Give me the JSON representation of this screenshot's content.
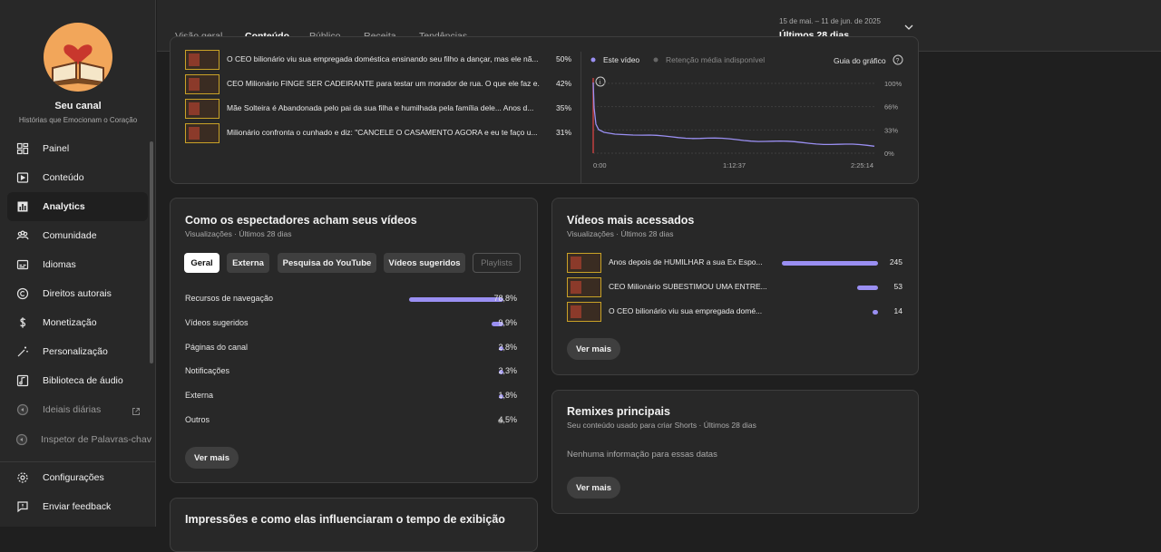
{
  "channel": {
    "name": "Seu canal",
    "subtitle": "Histórias que Emocionam o Coração"
  },
  "sidebar": {
    "items": [
      {
        "label": "Painel",
        "icon": "dashboard-icon"
      },
      {
        "label": "Conteúdo",
        "icon": "content-icon"
      },
      {
        "label": "Analytics",
        "icon": "analytics-icon",
        "active": true
      },
      {
        "label": "Comunidade",
        "icon": "community-icon"
      },
      {
        "label": "Idiomas",
        "icon": "subtitles-icon"
      },
      {
        "label": "Direitos autorais",
        "icon": "copyright-icon"
      },
      {
        "label": "Monetização",
        "icon": "dollar-icon"
      },
      {
        "label": "Personalização",
        "icon": "magic-wand-icon"
      },
      {
        "label": "Biblioteca de áudio",
        "icon": "audio-library-icon"
      },
      {
        "label": "Ideiais diárias",
        "icon": "extension-icon",
        "dim": true,
        "external": true
      },
      {
        "label": "Inspetor de Palavras-chav",
        "icon": "extension-icon",
        "dim": true
      }
    ],
    "bottom": [
      {
        "label": "Configurações",
        "icon": "gear-icon"
      },
      {
        "label": "Enviar feedback",
        "icon": "feedback-icon"
      }
    ]
  },
  "tabs": [
    "Visão geral",
    "Conteúdo",
    "Público",
    "Receita",
    "Tendências"
  ],
  "active_tab": 1,
  "date": {
    "range": "15 de mai. – 11 de jun. de 2025",
    "label": "Últimos 28 dias"
  },
  "retention_list": [
    {
      "title": "O CEO bilionário viu sua empregada doméstica ensinando seu filho a dançar, mas ele nã...",
      "value": "50%"
    },
    {
      "title": "CEO Milionário FINGE SER CADEIRANTE para testar um morador de rua. O que ele faz e...",
      "value": "42%"
    },
    {
      "title": "Mãe Solteira é Abandonada pelo pai da sua filha e humilhada pela família dele... Anos d...",
      "value": "35%"
    },
    {
      "title": "Milionário confronta o cunhado e diz: \"CANCELE O CASAMENTO AGORA e eu te faço u...",
      "value": "31%"
    }
  ],
  "retention_chart": {
    "legend_this": "Este vídeo",
    "legend_avg": "Retenção média indisponível",
    "guide": "Guia do gráfico",
    "y_ticks": [
      "100%",
      "66%",
      "33%",
      "0%"
    ],
    "x_ticks": [
      "0:00",
      "1:12:37",
      "2:25:14"
    ],
    "accent": "#9a8ff2"
  },
  "traffic": {
    "title": "Como os espectadores acham seus vídeos",
    "subtitle": "Visualizações · Últimos 28 dias",
    "filters": [
      "Geral",
      "Externa",
      "Pesquisa do YouTube",
      "Vídeos sugeridos",
      "Playlists"
    ],
    "sources": [
      {
        "label": "Recursos de navegação",
        "value": "78,8%",
        "pct": 78.8
      },
      {
        "label": "Vídeos sugeridos",
        "value": "9,9%",
        "pct": 9.9
      },
      {
        "label": "Páginas do canal",
        "value": "2,8%",
        "pct": 2.8
      },
      {
        "label": "Notificações",
        "value": "2,3%",
        "pct": 2.3
      },
      {
        "label": "Externa",
        "value": "1,8%",
        "pct": 1.8
      },
      {
        "label": "Outros",
        "value": "4,5%",
        "pct": 4.5
      }
    ],
    "more": "Ver mais"
  },
  "top_videos": {
    "title": "Vídeos mais acessados",
    "subtitle": "Visualizações · Últimos 28 dias",
    "items": [
      {
        "title": "Anos depois de HUMILHAR a sua Ex Espo...",
        "value": "245",
        "num": 245
      },
      {
        "title": "CEO Milionário SUBESTIMOU UMA ENTRE...",
        "value": "53",
        "num": 53
      },
      {
        "title": "O CEO bilionário viu sua empregada domé...",
        "value": "14",
        "num": 14
      }
    ],
    "more": "Ver mais"
  },
  "remixes": {
    "title": "Remixes principais",
    "subtitle": "Seu conteúdo usado para criar Shorts · Últimos 28 dias",
    "empty": "Nenhuma informação para essas datas",
    "more": "Ver mais"
  },
  "impressions": {
    "title": "Impressões e como elas influenciaram o tempo de exibição"
  }
}
